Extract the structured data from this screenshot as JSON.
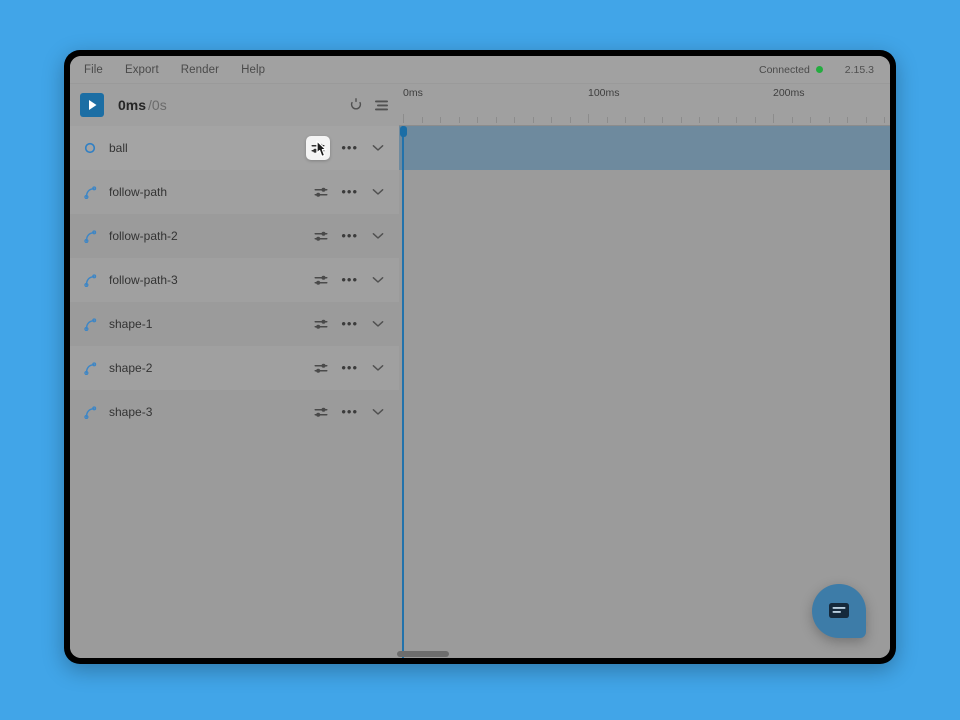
{
  "menu": {
    "items": [
      {
        "label": "File",
        "name": "menu-file"
      },
      {
        "label": "Export",
        "name": "menu-export"
      },
      {
        "label": "Render",
        "name": "menu-render"
      },
      {
        "label": "Help",
        "name": "menu-help"
      }
    ],
    "connection_status": "Connected",
    "connection_color": "#23ac3f",
    "version": "2.15.3"
  },
  "transport": {
    "play_icon": "play-icon",
    "current_time": "0ms",
    "total_time": "/0s",
    "tools": [
      {
        "name": "loop-icon",
        "label": "Loop"
      },
      {
        "name": "layers-icon",
        "label": "Layers"
      }
    ]
  },
  "ruler": {
    "labels": [
      {
        "text": "0ms",
        "ms": 0
      },
      {
        "text": "100ms",
        "ms": 100
      },
      {
        "text": "200ms",
        "ms": 200
      }
    ],
    "tick_interval_ms": 10,
    "pixels_per_ms": 1.85,
    "max_ms": 280
  },
  "playhead": {
    "position_ms": 0,
    "color": "#2272ab"
  },
  "layers": [
    {
      "name": "ball",
      "icon": "circle-icon",
      "selected": true,
      "settings_hovered": true
    },
    {
      "name": "follow-path",
      "icon": "bezier-path-icon",
      "selected": false,
      "settings_hovered": false
    },
    {
      "name": "follow-path-2",
      "icon": "bezier-path-icon",
      "selected": false,
      "settings_hovered": false
    },
    {
      "name": "follow-path-3",
      "icon": "bezier-path-icon",
      "selected": false,
      "settings_hovered": false
    },
    {
      "name": "shape-1",
      "icon": "bezier-path-icon",
      "selected": false,
      "settings_hovered": false
    },
    {
      "name": "shape-2",
      "icon": "bezier-path-icon",
      "selected": false,
      "settings_hovered": false
    },
    {
      "name": "shape-3",
      "icon": "bezier-path-icon",
      "selected": false,
      "settings_hovered": false
    }
  ],
  "row_controls": {
    "settings_icon": "sliders-icon",
    "more_label": "•••",
    "expand_icon": "chevron-down-icon"
  },
  "fab": {
    "name": "chat-fab",
    "icon": "chat-bubble-icon",
    "color": "#3d7ca8"
  },
  "colors": {
    "page_background": "#41a5e8",
    "window_background": "#9b9b9b",
    "selected_track": "#6e8a9e",
    "accent": "#1c6ea4"
  },
  "scrollbar": {
    "name": "horizontal-scrollbar"
  }
}
